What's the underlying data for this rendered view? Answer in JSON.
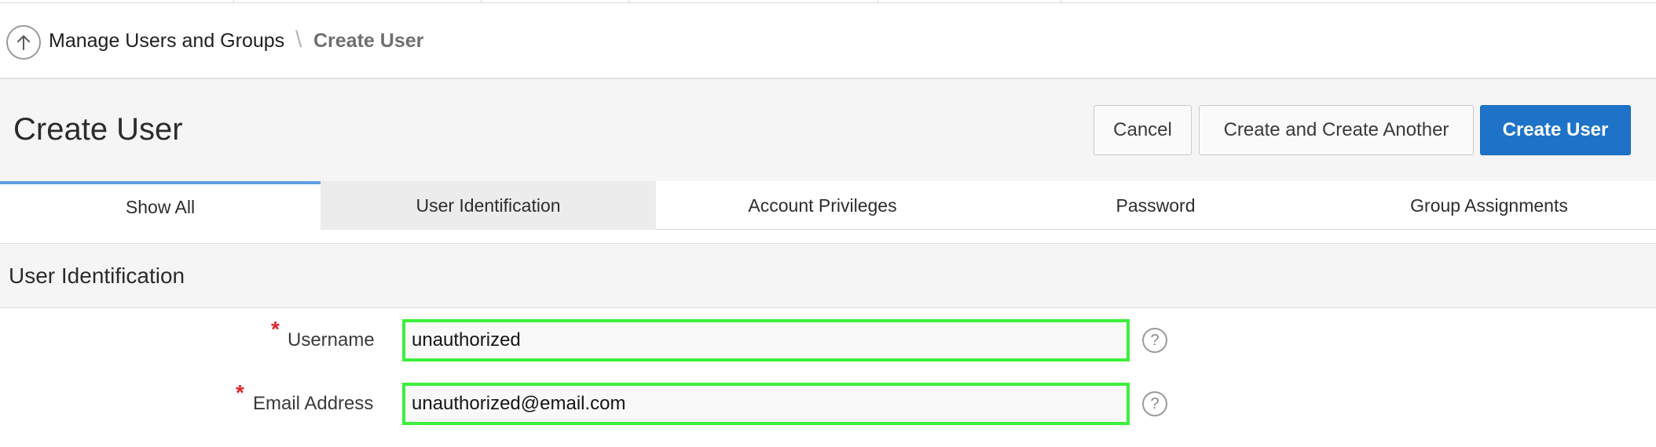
{
  "breadcrumb": {
    "parent": "Manage Users and Groups",
    "separator": "\\",
    "current": "Create User"
  },
  "header": {
    "title": "Create User",
    "buttons": {
      "cancel": "Cancel",
      "create_another": "Create and Create Another",
      "create": "Create User"
    }
  },
  "tabs": [
    {
      "label": "Show All",
      "state": "active"
    },
    {
      "label": "User Identification",
      "state": "hover"
    },
    {
      "label": "Account Privileges",
      "state": "normal"
    },
    {
      "label": "Password",
      "state": "normal"
    },
    {
      "label": "Group Assignments",
      "state": "normal"
    }
  ],
  "section": {
    "title": "User Identification"
  },
  "form": {
    "required_marker": "*",
    "help_glyph": "?",
    "username": {
      "label": "Username",
      "value": "unauthorized"
    },
    "email": {
      "label": "Email Address",
      "value": "unauthorized@email.com"
    }
  },
  "colors": {
    "primary_button": "#1e73c8",
    "active_tab_border": "#5f9fe0",
    "field_highlight": "#3cf03c",
    "required": "#e0262f"
  },
  "icons": {
    "back": "arrow-up-circle-icon",
    "help": "question-circle-icon"
  }
}
